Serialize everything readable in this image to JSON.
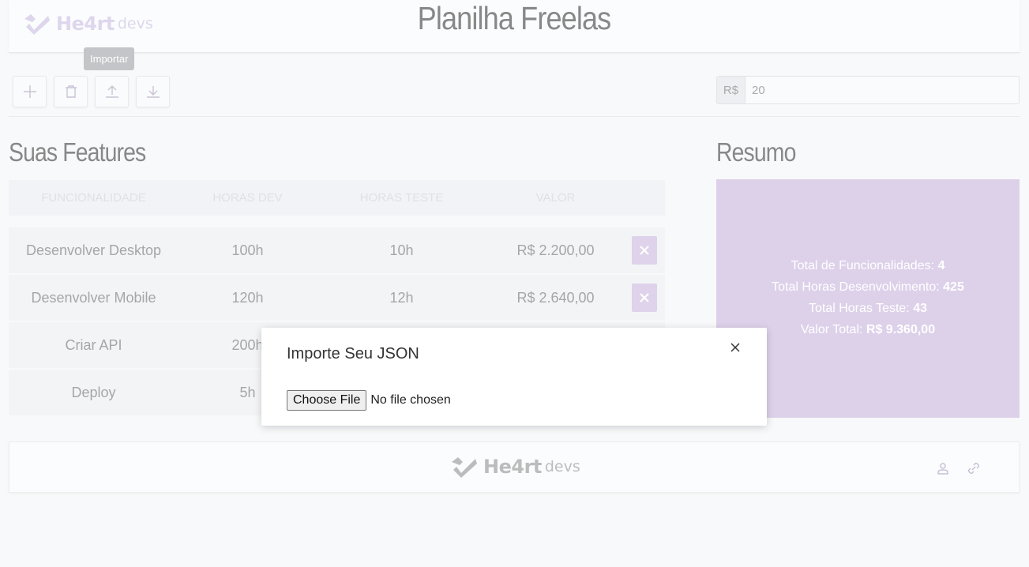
{
  "header": {
    "brand": "He4rt",
    "brand_sub": "devs",
    "title": "Planilha Freelas"
  },
  "toolbar": {
    "tooltip": "Importar",
    "buttons": [
      "add-icon",
      "trash-icon",
      "upload-icon",
      "download-icon"
    ],
    "currency_prefix": "R$",
    "price_value": "20"
  },
  "features": {
    "title": "Suas Features",
    "columns": [
      "FUNCIONALIDADE",
      "HORAS DEV",
      "HORAS TESTE",
      "VALOR"
    ],
    "rows": [
      {
        "name": "Desenvolver Desktop",
        "dev": "100h",
        "test": "10h",
        "value": "R$ 2.200,00"
      },
      {
        "name": "Desenvolver Mobile",
        "dev": "120h",
        "test": "12h",
        "value": "R$ 2.640,00"
      },
      {
        "name": "Criar API",
        "dev": "200h",
        "test": "",
        "value": ""
      },
      {
        "name": "Deploy",
        "dev": "5h",
        "test": "",
        "value": ""
      }
    ]
  },
  "resumo": {
    "title": "Resumo",
    "func_label": "Total de Funcionalidades:",
    "func_value": "4",
    "dev_label": "Total Horas Desenvolvimento:",
    "dev_value": "425",
    "test_label": "Total Horas Teste:",
    "test_value": "43",
    "valor_label": "Valor Total:",
    "valor_value": "R$ 9.360,00"
  },
  "footer": {
    "brand": "He4rt",
    "brand_sub": "devs",
    "icons": [
      "user-icon",
      "link-icon"
    ]
  },
  "modal": {
    "title": "Importe Seu JSON",
    "file_button": "Choose File",
    "file_status": "No file chosen"
  },
  "colors": {
    "accent": "#ded3ea",
    "resumo_bg": "#ddd1ea",
    "background": "#f8f9fa"
  }
}
